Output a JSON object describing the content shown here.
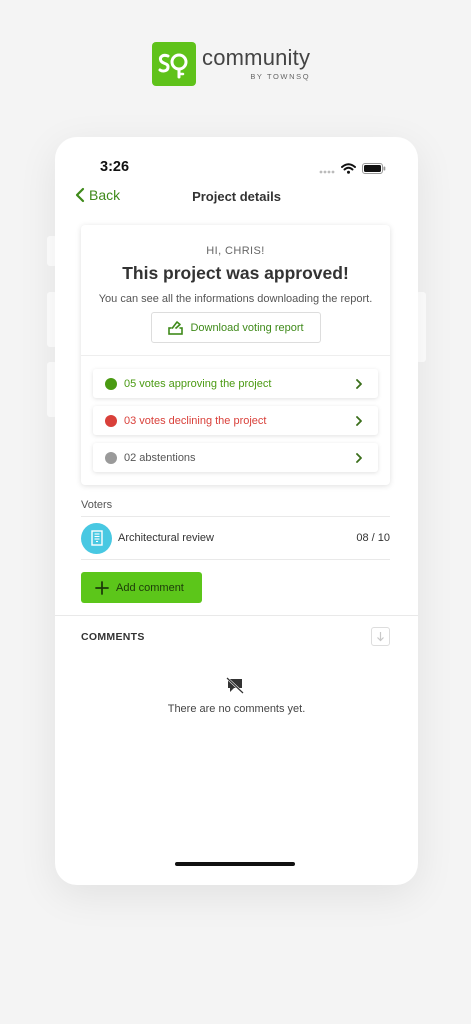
{
  "brand": {
    "name": "community",
    "sub": "BY TOWNSQ",
    "color": "#5fc21a"
  },
  "status_bar": {
    "time": "3:26"
  },
  "navbar": {
    "back_label": "Back",
    "title": "Project details"
  },
  "summary": {
    "greeting": "HI, CHRIS!",
    "headline": "This project was approved!",
    "subtext": "You can see all the informations downloading the report.",
    "download_label": "Download voting report"
  },
  "votes": [
    {
      "label": "05 votes approving the project",
      "color": "#4a9a12",
      "dot": "#4a9a12"
    },
    {
      "label": "03 votes declining the project",
      "color": "#d9403a",
      "dot": "#d9403a"
    },
    {
      "label": "02 abstentions",
      "color": "#555555",
      "dot": "#9a9a9a"
    }
  ],
  "voters": {
    "section_label": "Voters",
    "items": [
      {
        "name": "Architectural review",
        "count": "08 / 10",
        "icon": "building-icon"
      }
    ]
  },
  "actions": {
    "add_comment_label": "Add comment"
  },
  "comments": {
    "title": "COMMENTS",
    "empty_text": "There are no comments yet.",
    "empty_icon": "comment-off-icon"
  }
}
